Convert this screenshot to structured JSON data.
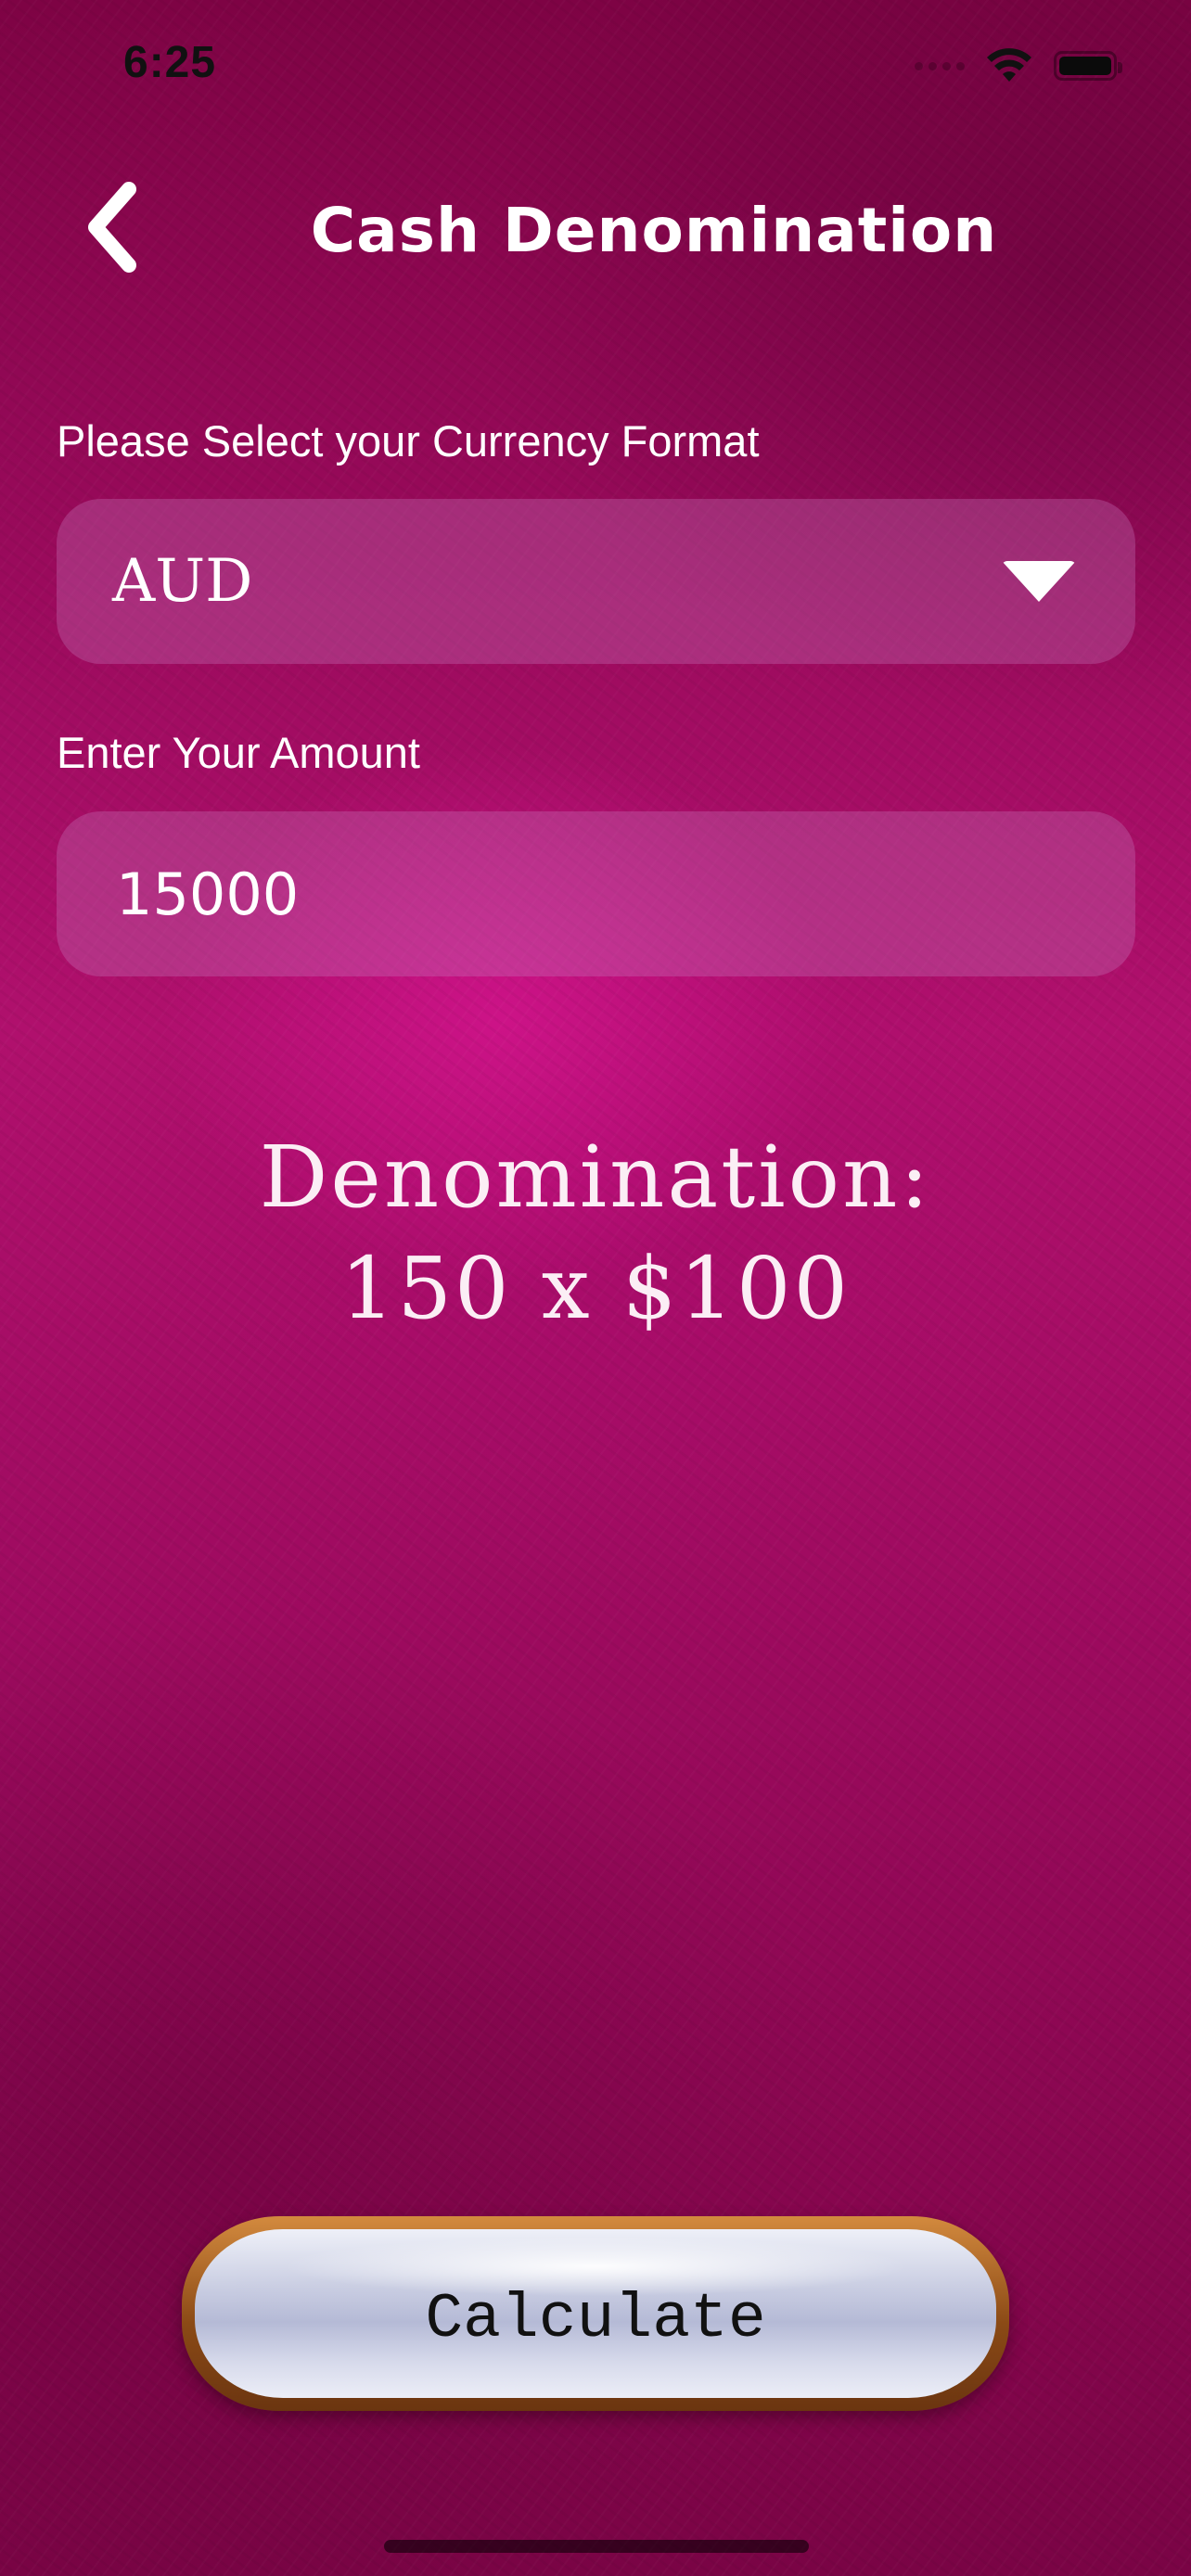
{
  "status_bar": {
    "time": "6:25"
  },
  "header": {
    "back_icon": "chevron-left-icon",
    "title": "Cash Denomination"
  },
  "currency": {
    "label": "Please Select your Currency Format",
    "selected": "AUD",
    "dropdown_icon": "triangle-down-icon"
  },
  "amount": {
    "label": "Enter Your Amount",
    "value": "15000"
  },
  "result": {
    "line1": "Denomination:",
    "line2": "150 x $100"
  },
  "calculate_button": {
    "label": "Calculate"
  },
  "colors": {
    "background": "#a00b61",
    "field_background": "#b04a8c",
    "text": "#ffffff"
  }
}
